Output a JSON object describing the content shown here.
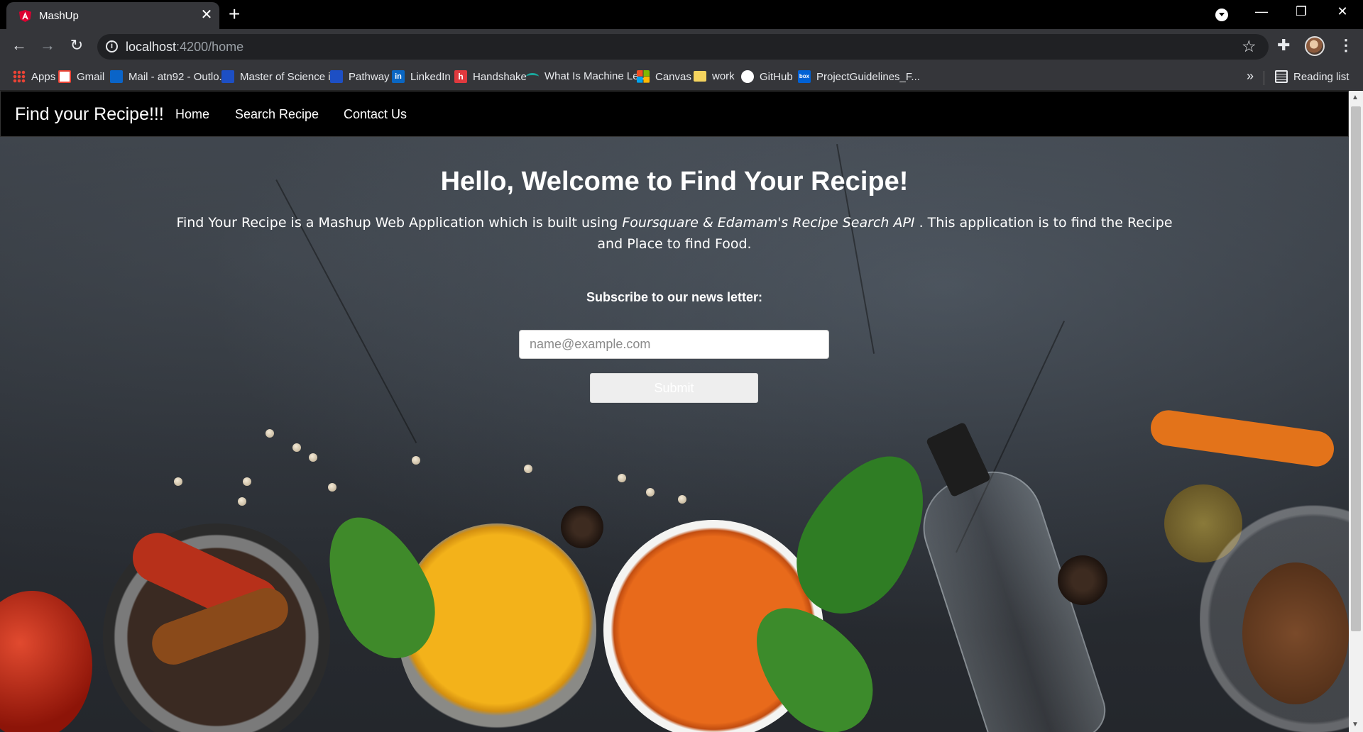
{
  "browser": {
    "tab_title": "MashUp",
    "url_host": "localhost",
    "url_path": ":4200/home",
    "bookmarks": [
      {
        "label": "Apps",
        "color": "#ea4335"
      },
      {
        "label": "Gmail",
        "color": "#ea4335"
      },
      {
        "label": "Mail - atn92 - Outlo...",
        "color": "#0a64c8"
      },
      {
        "label": "Master of Science i...",
        "color": "#1d4fc4"
      },
      {
        "label": "Pathway",
        "color": "#1d4fc4"
      },
      {
        "label": "LinkedIn",
        "color": "#0a66c2"
      },
      {
        "label": "Handshake",
        "color": "#e0393e"
      },
      {
        "label": "What Is Machine Le...",
        "color": "#19a89d"
      },
      {
        "label": "Canvas",
        "color": "#f25022"
      },
      {
        "label": "work",
        "color": "#f4d35e"
      },
      {
        "label": "GitHub",
        "color": "#ffffff"
      },
      {
        "label": "ProjectGuidelines_F...",
        "color": "#0061d5"
      }
    ],
    "reading_list": "Reading list"
  },
  "navbar": {
    "brand": "Find your Recipe!!!",
    "links": [
      "Home",
      "Search Recipe",
      "Contact Us"
    ]
  },
  "hero": {
    "welcome_prefix": "Hello, Welcome to ",
    "welcome_bold": "Find Your Recipe!",
    "intro_start": "Find Your Recipe is a Mashup Web Application which is built using ",
    "intro_italic": "Foursquare & Edamam's Recipe Search API",
    "intro_end": " . This application is to find the Recipe and Place to find Food.",
    "subscribe_label": "Subscribe to our news letter:",
    "email_placeholder": "name@example.com",
    "submit_label": "Submit"
  }
}
